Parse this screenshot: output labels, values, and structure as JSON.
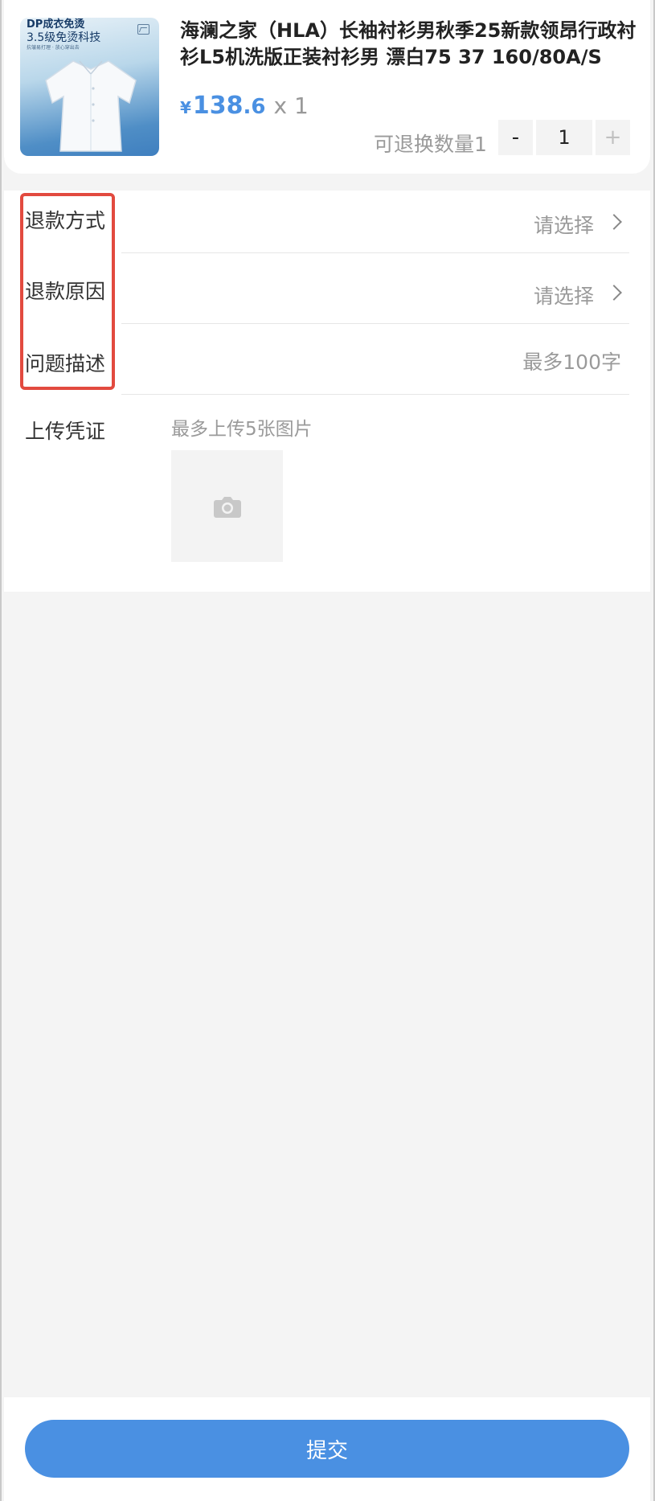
{
  "product": {
    "image_badge_line1": "DP成衣免烫",
    "image_badge_line2": "3.5级免烫科技",
    "image_badge_line3": "抗皱易打理 · 放心穿出去",
    "title": "海澜之家（HLA）长袖衬衫男秋季25新款领昂行政衬衫L5机洗版正装衬衫男 漂白75 37 160/80A/S",
    "price_symbol": "¥",
    "price_integer": "138",
    "price_decimal": ".6",
    "quantity_text": "x 1",
    "refundable_label": "可退换数量1",
    "stepper": {
      "minus": "-",
      "value": "1",
      "plus": "+"
    }
  },
  "form": {
    "refund_method": {
      "label": "退款方式",
      "placeholder": "请选择"
    },
    "refund_reason": {
      "label": "退款原因",
      "placeholder": "请选择"
    },
    "problem_description": {
      "label": "问题描述",
      "placeholder": "最多100字"
    },
    "upload": {
      "label": "上传凭证",
      "hint": "最多上传5张图片",
      "icon": "camera-icon"
    }
  },
  "submit_label": "提交",
  "colors": {
    "accent": "#4a90e2",
    "highlight": "#e24a3f",
    "muted": "#9a9a9a"
  }
}
